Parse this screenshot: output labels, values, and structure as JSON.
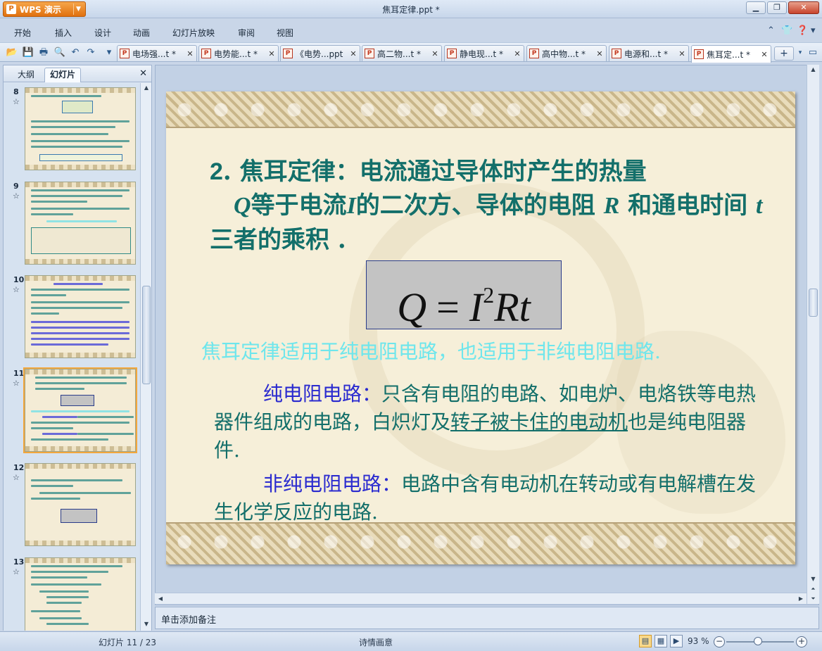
{
  "app": {
    "brand": "WPS 演示",
    "window_title": "焦耳定律.ppt *"
  },
  "menu": [
    "开始",
    "插入",
    "设计",
    "动画",
    "幻灯片放映",
    "审阅",
    "视图"
  ],
  "tabs": [
    {
      "label": "电场强...t *"
    },
    {
      "label": "电势能...t *"
    },
    {
      "label": "《电势...ppt"
    },
    {
      "label": "高二物...t *"
    },
    {
      "label": "静电现...t *"
    },
    {
      "label": "高中物...t *"
    },
    {
      "label": "电源和...t *"
    },
    {
      "label": "焦耳定...t *"
    }
  ],
  "pane": {
    "tab_outline": "大纲",
    "tab_slides": "幻灯片",
    "thumbnails": [
      {
        "number": "8"
      },
      {
        "number": "9"
      },
      {
        "number": "10"
      },
      {
        "number": "11",
        "selected": true
      },
      {
        "number": "12"
      },
      {
        "number": "13"
      }
    ]
  },
  "slide": {
    "heading_num": "2",
    "heading_a": ". 焦耳定律：电流通过导体时产生的热量",
    "heading_Q": "Q",
    "heading_b": "等于电流",
    "heading_I": "I",
    "heading_c": "的二次方、导体的电阻 ",
    "heading_R": "R",
    "heading_d": " 和通电时间 ",
    "heading_t": "t",
    "heading_e": " 三者的乘积 .",
    "formula_left": "Q",
    "formula_eq": "=",
    "formula_I": "I",
    "formula_exp": "2",
    "formula_rest": "Rt",
    "applies": "焦耳定律适用于纯电阻电路，也适用于非纯电阻电路.",
    "pure_lead": "纯电阻电路：",
    "pure_body_a": "只含有电阻的电路、如电炉、电烙铁等电热器件组成的电路，白炽灯及",
    "pure_underlined": "转子被卡住的电动机",
    "pure_body_b": "也是纯电阻器件.",
    "nonpure_lead": "非纯电阻电路：",
    "nonpure_body": "电路中含有电动机在转动或有电解槽在发生化学反应的电路."
  },
  "notes_placeholder": "单击添加备注",
  "status": {
    "slide_counter": "幻灯片 11 / 23",
    "theme": "诗情画意",
    "zoom": "93 %"
  }
}
